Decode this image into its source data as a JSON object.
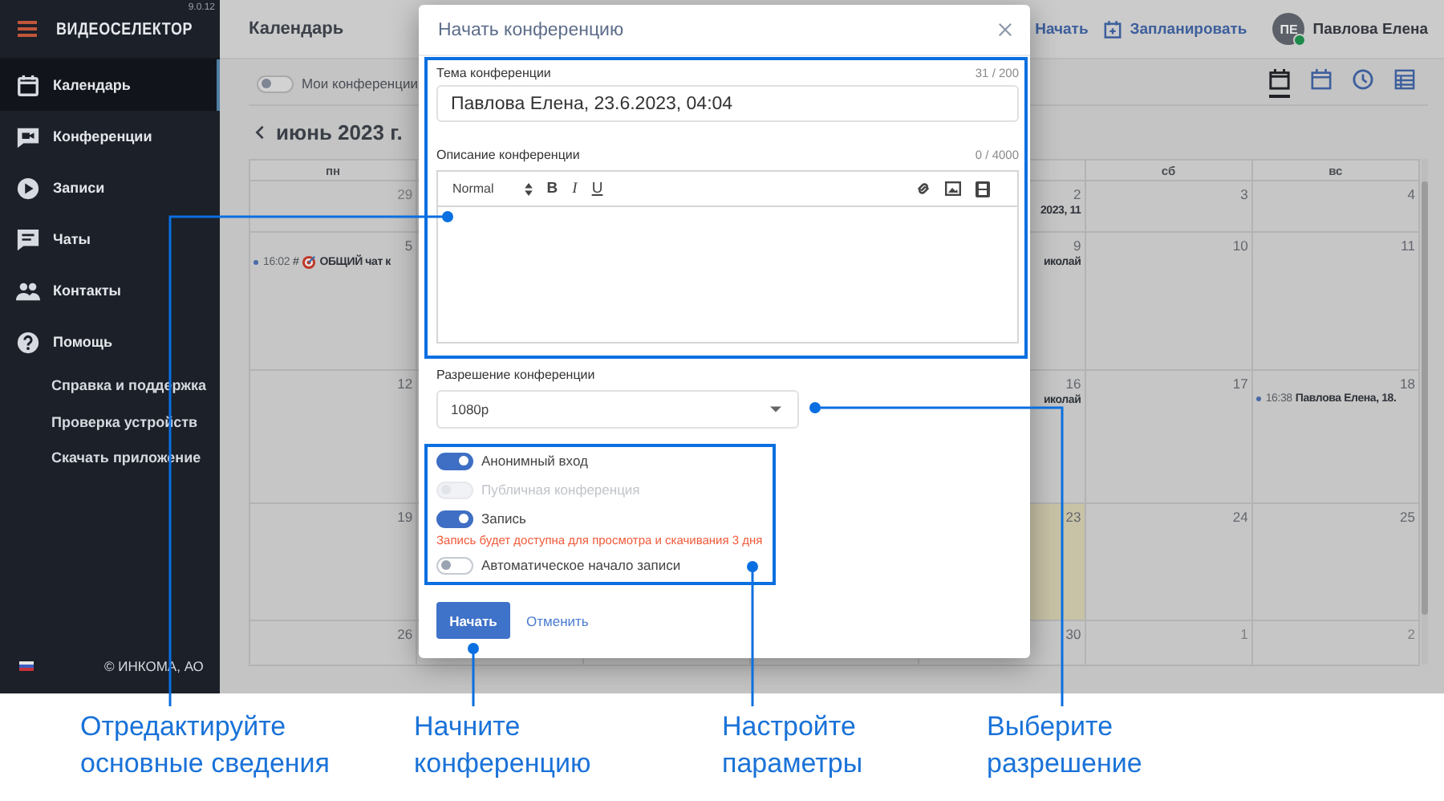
{
  "sidebar": {
    "version": "9.0.12",
    "logo": "ВИДЕОСЕЛЕКТОР",
    "items": [
      {
        "label": "Календарь",
        "kind": "calendar",
        "selected": true
      },
      {
        "label": "Конференции",
        "kind": "conference",
        "selected": false
      },
      {
        "label": "Записи",
        "kind": "recordings",
        "selected": false
      },
      {
        "label": "Чаты",
        "kind": "chats",
        "selected": false
      },
      {
        "label": "Контакты",
        "kind": "contacts",
        "selected": false
      },
      {
        "label": "Помощь",
        "kind": "help",
        "selected": false
      }
    ],
    "help_links": [
      "Справка и поддержка",
      "Проверка устройств",
      "Скачать приложение"
    ],
    "copyright": "© ИНКОМА, АО"
  },
  "header": {
    "title": "Календарь",
    "actions": [
      {
        "label": "Начать",
        "kind": "start"
      },
      {
        "label": "Запланировать",
        "kind": "schedule"
      }
    ],
    "user": {
      "initials": "ПЕ",
      "name": "Павлова Елена",
      "online": true
    }
  },
  "toolbar": {
    "my_conferences": {
      "label": "Мои конференции",
      "on": false
    },
    "views": [
      {
        "kind": "day",
        "selected": true
      },
      {
        "kind": "month",
        "selected": false
      },
      {
        "kind": "clock",
        "selected": false
      },
      {
        "kind": "list",
        "selected": false
      }
    ]
  },
  "calendar": {
    "month": "июнь 2023 г.",
    "headers": {
      "mon": "пн",
      "sat": "сб",
      "sun": "вс"
    },
    "weeks": [
      {
        "mon": {
          "day": "29",
          "muted": true,
          "today": false
        },
        "fri": {
          "day": "2",
          "muted": false,
          "today": false,
          "events": [
            {
              "title": "2023, 11"
            }
          ]
        },
        "sat": {
          "day": "3",
          "muted": false,
          "today": false
        },
        "sun": {
          "day": "4",
          "muted": false,
          "today": false
        }
      },
      {
        "mon": {
          "day": "5",
          "muted": false,
          "today": false,
          "events": [
            {
              "time": "16:02",
              "prefix": "#",
              "title": "ОБЩИЙ чат к"
            }
          ]
        },
        "fri": {
          "day": "9",
          "muted": false,
          "today": false,
          "events": [
            {
              "title": "иколай"
            }
          ]
        },
        "sat": {
          "day": "10",
          "muted": false,
          "today": false
        },
        "sun": {
          "day": "11",
          "muted": false,
          "today": false
        }
      },
      {
        "mon": {
          "day": "12",
          "muted": false,
          "today": false
        },
        "fri": {
          "day": "16",
          "muted": false,
          "today": false,
          "events": [
            {
              "title": "иколай"
            }
          ]
        },
        "sat": {
          "day": "17",
          "muted": false,
          "today": false
        },
        "sun": {
          "day": "18",
          "muted": false,
          "today": false,
          "events": [
            {
              "time": "16:38",
              "title": "Павлова Елена, 18."
            }
          ]
        }
      },
      {
        "mon": {
          "day": "19",
          "muted": false,
          "today": false
        },
        "fri": {
          "day": "23",
          "muted": false,
          "today": true
        },
        "sat": {
          "day": "24",
          "muted": false,
          "today": false
        },
        "sun": {
          "day": "25",
          "muted": false,
          "today": false
        }
      },
      {
        "mon": {
          "day": "26",
          "muted": false,
          "today": false
        },
        "fri": {
          "day": "30",
          "muted": false,
          "today": false
        },
        "sat": {
          "day": "1",
          "muted": true,
          "today": false
        },
        "sun": {
          "day": "2",
          "muted": true,
          "today": false
        }
      }
    ]
  },
  "dialog": {
    "title": "Начать конференцию",
    "topic": {
      "label": "Тема конференции",
      "counter": "31 / 200",
      "value": "Павлова Елена, 23.6.2023, 04:04"
    },
    "description": {
      "label": "Описание конференции",
      "counter": "0 / 4000",
      "format": "Normal",
      "format_buttons": [
        "B",
        "I",
        "U"
      ]
    },
    "resolution": {
      "label": "Разрешение конференции",
      "value": "1080p"
    },
    "options": [
      {
        "label": "Анонимный вход",
        "on": true,
        "disabled": false
      },
      {
        "label": "Публичная конференция",
        "on": false,
        "disabled": true
      },
      {
        "label": "Запись",
        "on": true,
        "disabled": false,
        "note": "Запись будет доступна для просмотра и скачивания 3 дня"
      },
      {
        "label": "Автоматическое начало записи",
        "on": false,
        "disabled": false
      }
    ],
    "buttons": {
      "primary": "Начать",
      "secondary": "Отменить"
    }
  },
  "annotations": [
    "Отредактируйте основные сведения",
    "Начните конференцию",
    "Настройте параметры",
    "Выберите разрешение"
  ]
}
